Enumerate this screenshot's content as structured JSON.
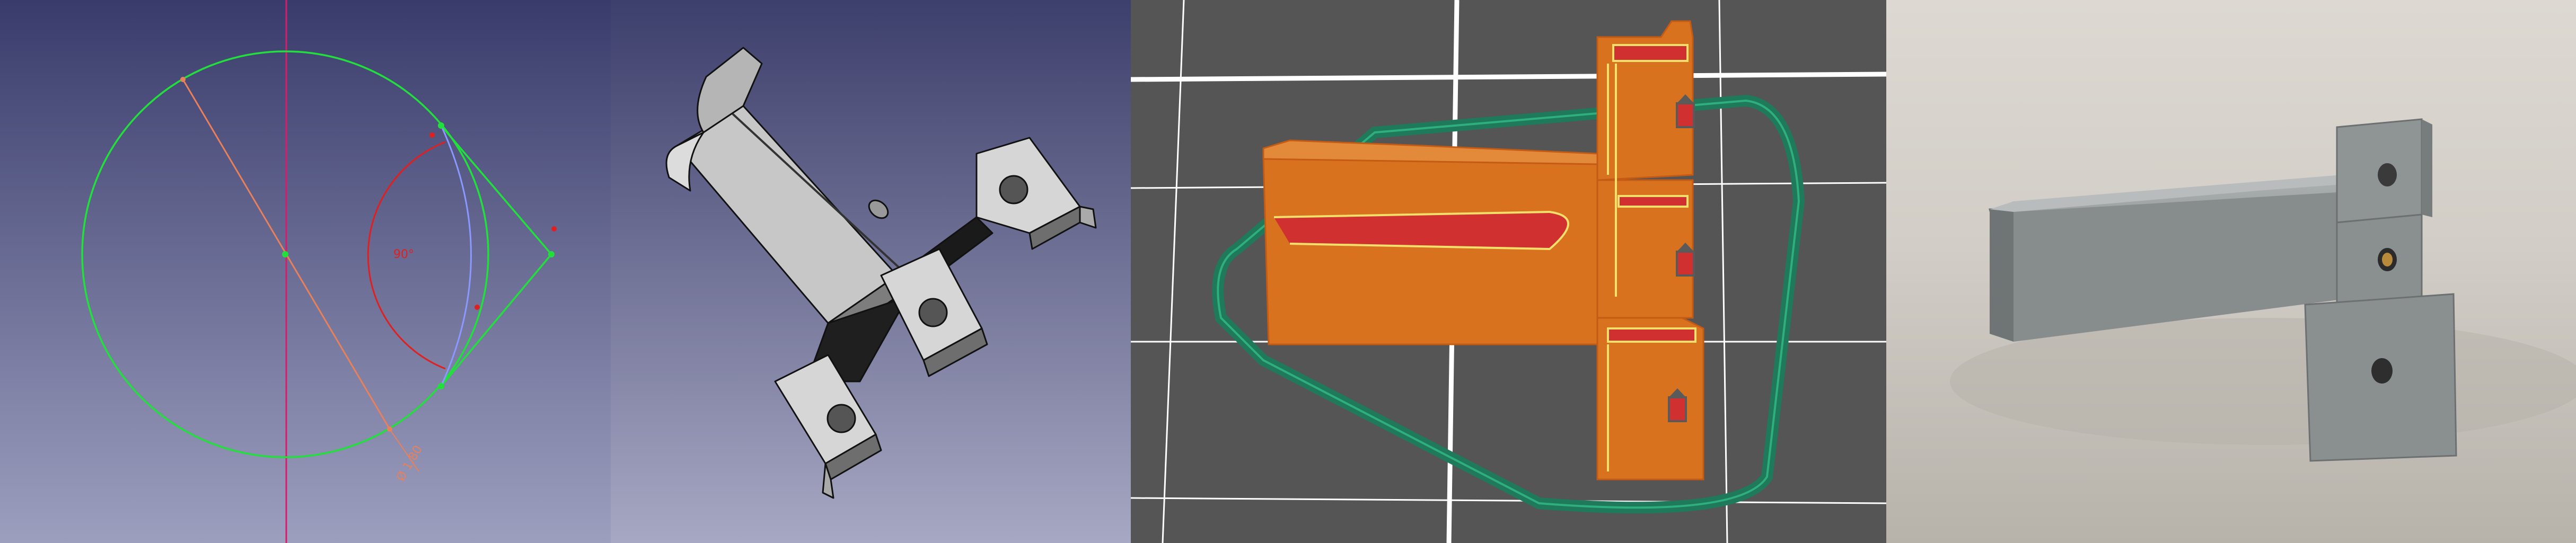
{
  "panels": [
    {
      "name": "freecad-sketch-view"
    },
    {
      "name": "freecad-3d-model-view"
    },
    {
      "name": "slicer-preview-view"
    },
    {
      "name": "printed-part-photo"
    }
  ],
  "sketch": {
    "angle_label": "90°",
    "diameter_label": "Ø 1.80"
  },
  "colors": {
    "sketch_bg_top": "#393c6b",
    "sketch_line": "#22e03c",
    "axis_red": "#d61c6a",
    "dimension": "#e8805c",
    "constraint": "#e02020",
    "slicer_orange": "#d8721e",
    "slicer_red": "#d03030",
    "slicer_skirt": "#1e7a5a",
    "part_grey": "#c7c7c7",
    "printed_grey": "#8e9394"
  }
}
